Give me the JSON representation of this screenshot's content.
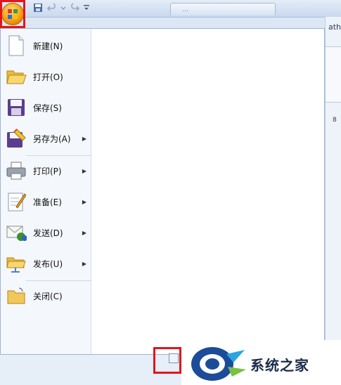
{
  "titlebar": {
    "doc_tab": "…",
    "right_fragment": "ath",
    "cell_value": "8"
  },
  "menu": {
    "items": [
      {
        "label": "新建(N)",
        "icon": "new-doc-icon",
        "submenu": false
      },
      {
        "label": "打开(O)",
        "icon": "open-folder-icon",
        "submenu": false
      },
      {
        "label": "保存(S)",
        "icon": "save-disk-icon",
        "submenu": false
      },
      {
        "label": "另存为(A)",
        "icon": "save-as-icon",
        "submenu": true
      },
      {
        "label": "打印(P)",
        "icon": "printer-icon",
        "submenu": true
      },
      {
        "label": "准备(E)",
        "icon": "prepare-icon",
        "submenu": true
      },
      {
        "label": "发送(D)",
        "icon": "send-icon",
        "submenu": true
      },
      {
        "label": "发布(U)",
        "icon": "publish-icon",
        "submenu": true
      },
      {
        "label": "关闭(C)",
        "icon": "close-folder-icon",
        "submenu": false
      }
    ]
  },
  "watermark": {
    "text": "系统之家"
  },
  "colors": {
    "highlight_red": "#e0161b",
    "office_orange": "#f39a12",
    "chrome_blue": "#c9d8ee"
  }
}
